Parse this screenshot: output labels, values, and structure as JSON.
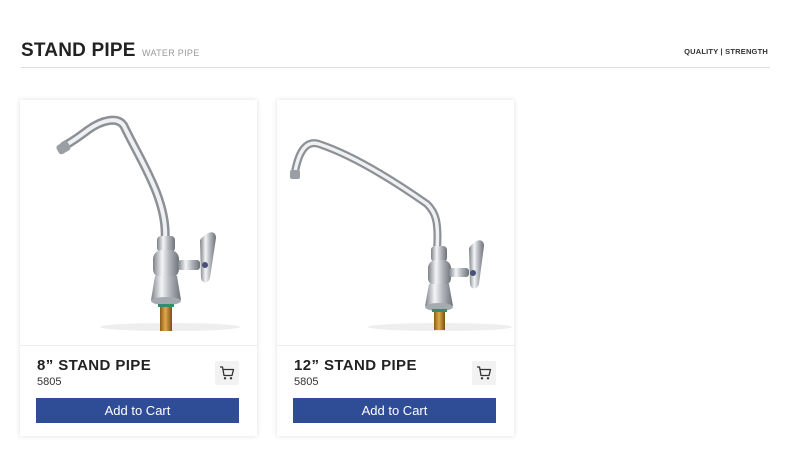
{
  "header": {
    "title": "STAND PIPE",
    "subtitle": "WATER PIPE",
    "tagline": "QUALITY | STRENGTH"
  },
  "products": [
    {
      "name": "8” STAND PIPE",
      "code": "5805",
      "button_label": "Add to Cart",
      "cart_icon": "shopping-cart-icon"
    },
    {
      "name": "12” STAND PIPE",
      "code": "5805",
      "button_label": "Add to Cart",
      "cart_icon": "shopping-cart-icon"
    }
  ],
  "colors": {
    "button": "#2f4c97",
    "chrome": "#c9ccd1",
    "brass": "#c98b2c"
  }
}
